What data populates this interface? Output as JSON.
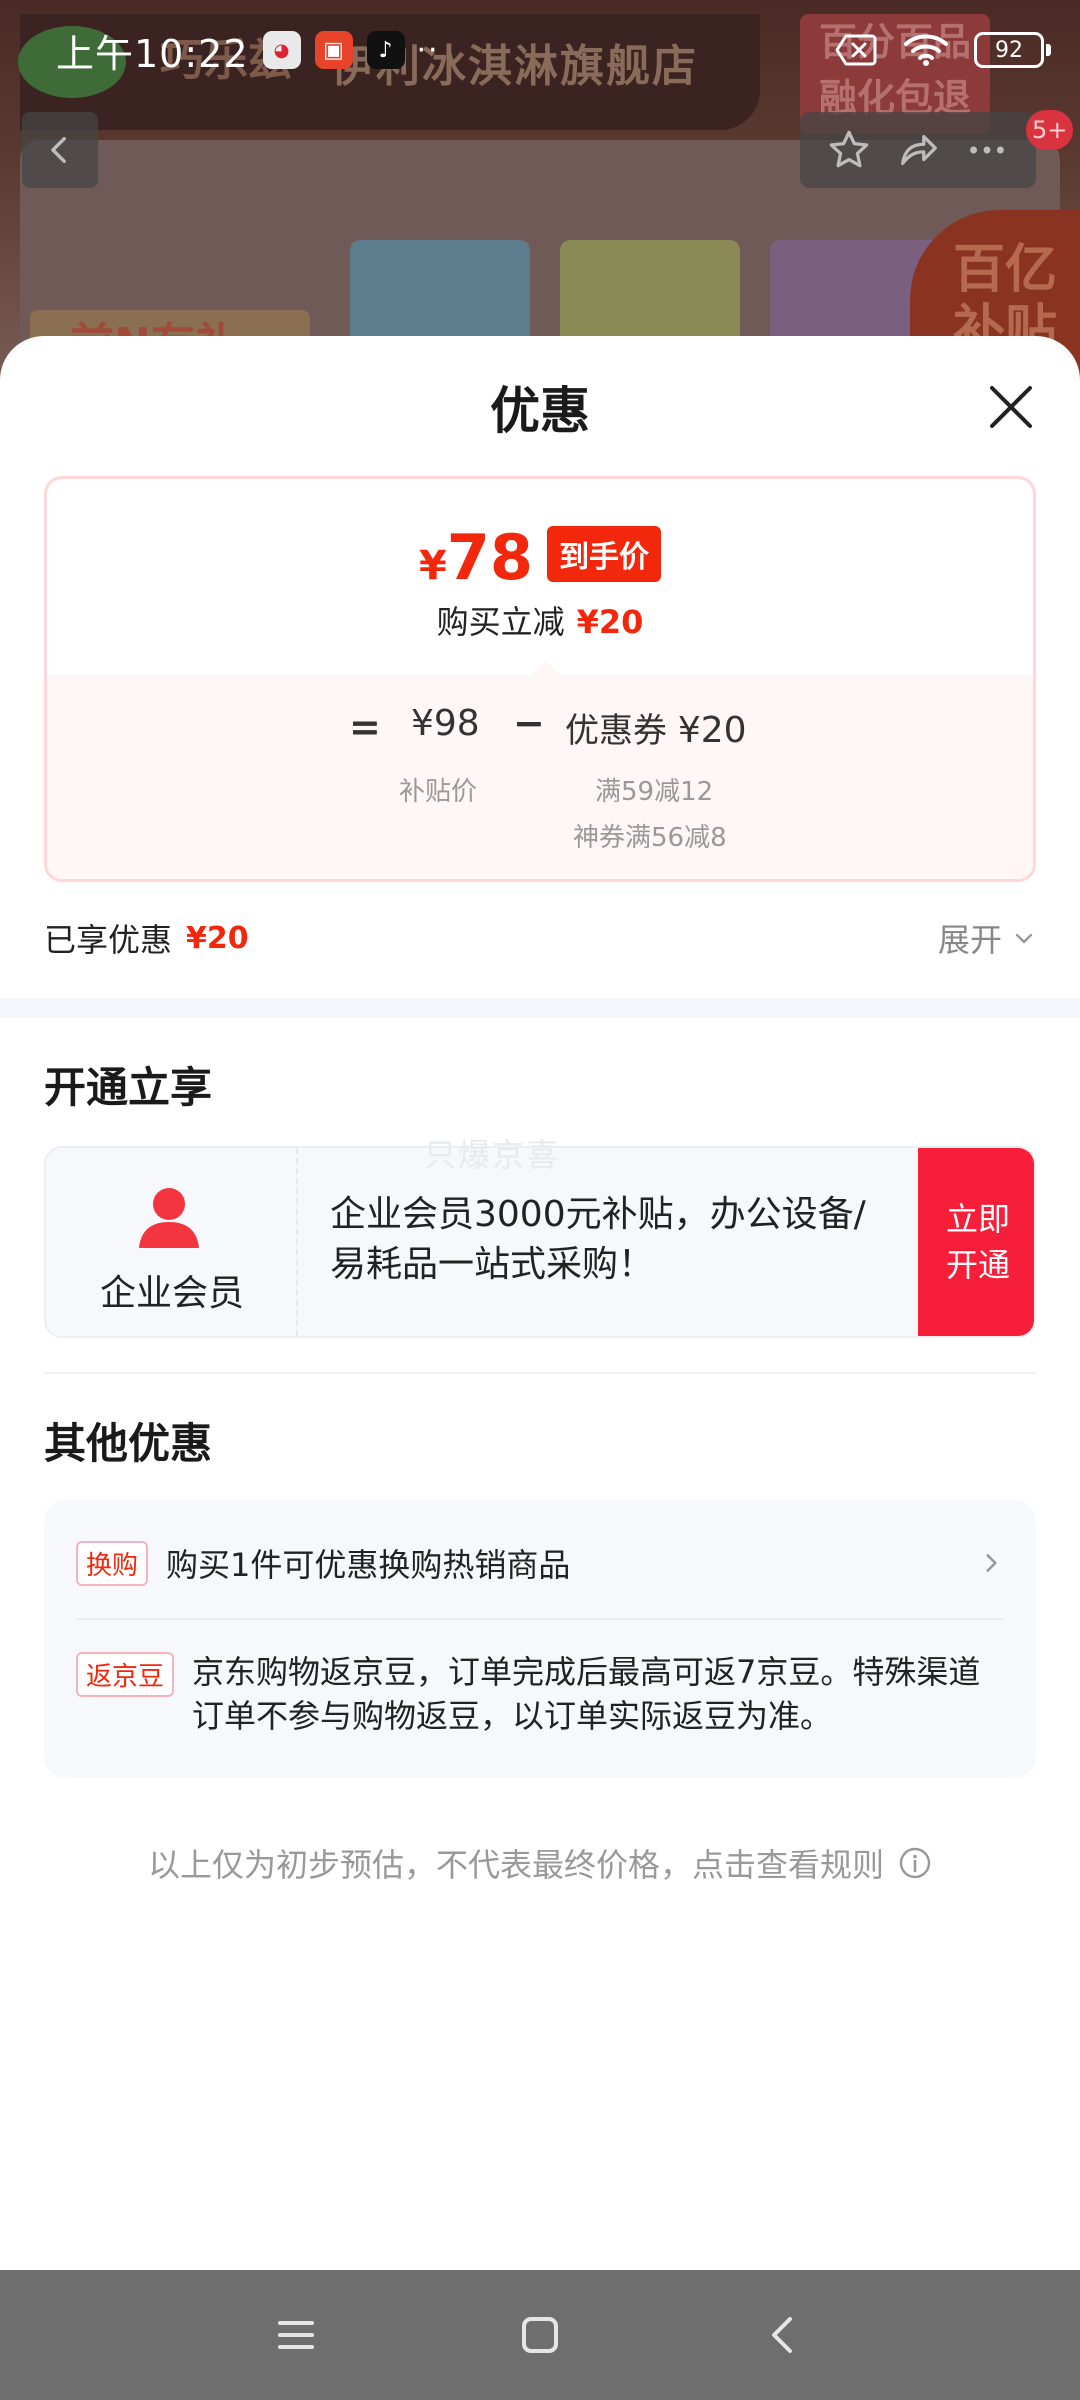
{
  "status_bar": {
    "time": "上午10:22",
    "battery": "92",
    "more": "··"
  },
  "background_page": {
    "store_name": "伊利冰淇淋旗舰店",
    "brand": "巧乐兹",
    "badge_lines": [
      "百分百品",
      "融化包退"
    ],
    "left_tag": "前N有礼",
    "subsidy_lines": [
      "百亿",
      "补贴"
    ],
    "message_count": "5+"
  },
  "sheet": {
    "title": "优惠",
    "price": {
      "currency": "¥",
      "final_price": "78",
      "price_tag": "到手价",
      "instant_label": "购买立减",
      "instant_amount": "¥20"
    },
    "calc": {
      "equals": "=",
      "subsidy_price": "¥98",
      "minus": "−",
      "coupon_label": "优惠券",
      "coupon_value": "¥20",
      "subsidy_label": "补贴价",
      "coupon_detail_1": "满59减12",
      "coupon_detail_2": "神券满56减8"
    },
    "enjoyed": {
      "label": "已享优惠",
      "amount": "¥20",
      "expand_label": "展开"
    },
    "open_section": {
      "title": "开通立享",
      "watermark": "只爆京喜",
      "member_name": "企业会员",
      "member_desc": "企业会员3000元补贴，办公设备/易耗品一站式采购！",
      "button_label": "立即开通"
    },
    "other_section": {
      "title": "其他优惠",
      "items": [
        {
          "tag": "换购",
          "text": "购买1件可优惠换购热销商品"
        },
        {
          "tag": "返京豆",
          "text": "京东购物返京豆，订单完成后最高可返7京豆。特殊渠道订单不参与购物返豆，以订单实际返豆为准。"
        }
      ]
    },
    "disclaimer": "以上仅为初步预估，不代表最终价格，点击查看规则"
  },
  "colors": {
    "accent_red": "#f2270c",
    "button_red": "#f71e3a",
    "nav_gray": "#6e6e6e"
  },
  "icons": {
    "close": "close-icon",
    "expand": "chevron-down-icon",
    "member": "person-icon",
    "row_arrow": "chevron-right-icon",
    "info": "info-icon",
    "nav": [
      "menu-icon",
      "home-square-icon",
      "back-icon"
    ]
  }
}
